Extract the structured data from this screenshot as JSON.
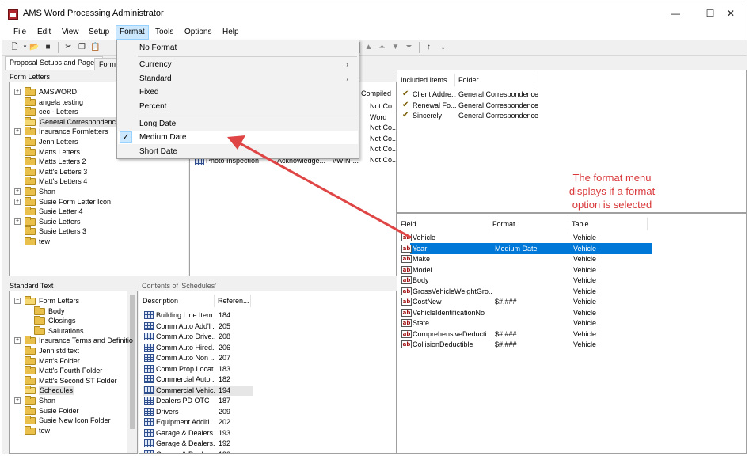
{
  "window": {
    "title": "AMS Word Processing Administrator",
    "minimize": "—",
    "maximize": "☐",
    "close": "✕"
  },
  "menu": [
    "File",
    "Edit",
    "View",
    "Setup",
    "Format",
    "Tools",
    "Options",
    "Help"
  ],
  "tabs": [
    "Proposal Setups and Pages",
    "Form"
  ],
  "format_menu": {
    "items": [
      "No Format",
      "Currency",
      "Standard",
      "Fixed",
      "Percent",
      "Long Date",
      "Medium Date",
      "Short Date"
    ],
    "checked": "Medium Date",
    "check_glyph": "✓",
    "arrow_glyph": "›"
  },
  "form_letters": {
    "title": "Form Letters",
    "items": [
      "AMSWORD",
      "angela testing",
      "cec - Letters",
      "General Correspondence",
      "Insurance Formletters",
      "Jenn Letters",
      "Matts Letters",
      "Matts Letters 2",
      "Matt's Letters 3",
      "Matt's Letters 4",
      "Shan",
      "Susie Form Letter Icon",
      "Susie Letter 4",
      "Susie Letters",
      "Susie Letters 3",
      "tew"
    ],
    "selected": "General Correspondence"
  },
  "letters_list": {
    "compiled_header": "Compiled",
    "compiled": [
      "Not Co...",
      "Word",
      "Not Co...",
      "Not Co...",
      "Not Co...",
      "Not Co..."
    ],
    "partial_header": "e",
    "last_row": [
      "Photo Inspection",
      "Acknowledge...",
      "\\\\WIN-..."
    ]
  },
  "included": {
    "headers": [
      "Included Items",
      "Folder"
    ],
    "rows": [
      [
        "Client Addre...",
        "General Correspondence"
      ],
      [
        "Renewal Fo...",
        "General Correspondence"
      ],
      [
        "Sincerely",
        "General Correspondence"
      ]
    ]
  },
  "annotation": "The format menu displays if a format option is selected",
  "fields": {
    "headers": [
      "Field",
      "Format",
      "Table"
    ],
    "rows": [
      [
        "Vehicle",
        "",
        "Vehicle"
      ],
      [
        "Year",
        "Medium Date",
        "Vehicle"
      ],
      [
        "Make",
        "",
        "Vehicle"
      ],
      [
        "Model",
        "",
        "Vehicle"
      ],
      [
        "Body",
        "",
        "Vehicle"
      ],
      [
        "GrossVehicleWeightGro...",
        "",
        "Vehicle"
      ],
      [
        "CostNew",
        "$#,###",
        "Vehicle"
      ],
      [
        "VehicleIdentificationNo",
        "",
        "Vehicle"
      ],
      [
        "State",
        "",
        "Vehicle"
      ],
      [
        "ComprehensiveDeducti...",
        "$#,###",
        "Vehicle"
      ],
      [
        "CollisionDeductible",
        "$#,###",
        "Vehicle"
      ]
    ],
    "selected": "Year",
    "field_icon_text": "ab"
  },
  "standard_text": {
    "title": "Standard Text",
    "items": [
      "Form Letters",
      "Body",
      "Closings",
      "Salutations",
      "Insurance Terms and Definitio",
      "Jenn std text",
      "Matt's Folder",
      "Matt's Fourth Folder",
      "Matt's Second ST Folder",
      "Schedules",
      "Shan",
      "Susie Folder",
      "Susie New Icon Folder",
      "tew"
    ],
    "selected": "Schedules"
  },
  "schedules": {
    "title": "Contents of 'Schedules'",
    "headers": [
      "Description",
      "Referen..."
    ],
    "rows": [
      [
        "Building Line Item...",
        "184"
      ],
      [
        "Comm Auto Add'l ...",
        "205"
      ],
      [
        "Comm Auto Drive...",
        "208"
      ],
      [
        "Comm Auto Hired...",
        "206"
      ],
      [
        "Comm Auto Non ...",
        "207"
      ],
      [
        "Comm Prop Locat...",
        "183"
      ],
      [
        "Commercial Auto ...",
        "182"
      ],
      [
        "Commercial Vehic...",
        "194"
      ],
      [
        "Dealers PD OTC",
        "187"
      ],
      [
        "Drivers",
        "209"
      ],
      [
        "Equipment Additi...",
        "202"
      ],
      [
        "Garage & Dealers...",
        "193"
      ],
      [
        "Garage & Dealers...",
        "192"
      ],
      [
        "Garage & Dealers...",
        "190"
      ]
    ],
    "selected_index": 7
  },
  "colors": {
    "accent": "#0078d7",
    "annotation": "#d9383a",
    "arrow": "#e04545",
    "menu_highlight": "#cce8ff"
  }
}
